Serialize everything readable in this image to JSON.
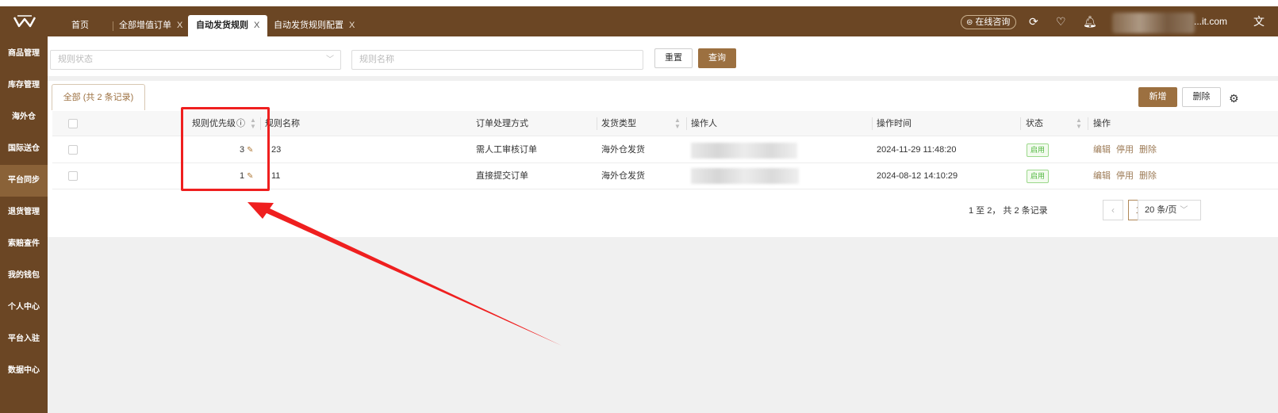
{
  "window": {
    "user_email_suffix": "...it.com"
  },
  "tabs": [
    {
      "label": "首页",
      "closable": false
    },
    {
      "label": "全部增值订单",
      "closable": true
    },
    {
      "label": "自动发货规则",
      "closable": true,
      "active": true
    },
    {
      "label": "自动发货规则配置",
      "closable": true
    }
  ],
  "tab_close_glyph": "X",
  "header": {
    "consult_label": "在线咨询",
    "icons": [
      "refresh-icon",
      "heart-icon",
      "bell-icon",
      "translate-icon"
    ]
  },
  "sidebar": {
    "items": [
      {
        "label": "商品管理"
      },
      {
        "label": "库存管理"
      },
      {
        "label": "海外仓"
      },
      {
        "label": "国际送仓"
      },
      {
        "label": "平台同步",
        "active": true
      },
      {
        "label": "退货管理"
      },
      {
        "label": "索赔查件"
      },
      {
        "label": "我的钱包"
      },
      {
        "label": "个人中心"
      },
      {
        "label": "平台入驻"
      },
      {
        "label": "数据中心"
      }
    ]
  },
  "filters": {
    "status_placeholder": "规则状态",
    "name_placeholder": "规则名称",
    "reset_label": "重置",
    "query_label": "查询"
  },
  "panel": {
    "tab_label": "全部 (共 2 条记录)",
    "add_label": "新增",
    "delete_label": "删除"
  },
  "table": {
    "columns": [
      "规则优先级",
      "规则名称",
      "订单处理方式",
      "发货类型",
      "操作人",
      "操作时间",
      "状态",
      "操作"
    ],
    "rows": [
      {
        "priority": "3",
        "name": "23",
        "method": "需人工审核订单",
        "ship_type": "海外仓发货",
        "operator": "",
        "time": "2024-11-29 11:48:20",
        "status": "启用"
      },
      {
        "priority": "1",
        "name": "11",
        "method": "直接提交订单",
        "ship_type": "海外仓发货",
        "operator": "",
        "time": "2024-08-12 14:10:29",
        "status": "启用"
      }
    ],
    "actions": [
      "编辑",
      "停用",
      "删除"
    ]
  },
  "pagination": {
    "summary": "1 至 2， 共 2 条记录",
    "current_page": "1",
    "page_size": "20 条/页"
  },
  "annotation": {
    "color": "#ef1f1f"
  },
  "colors": {
    "brand_brown": "#6b4624",
    "accent": "#9c7040",
    "status_green": "#52b840"
  }
}
